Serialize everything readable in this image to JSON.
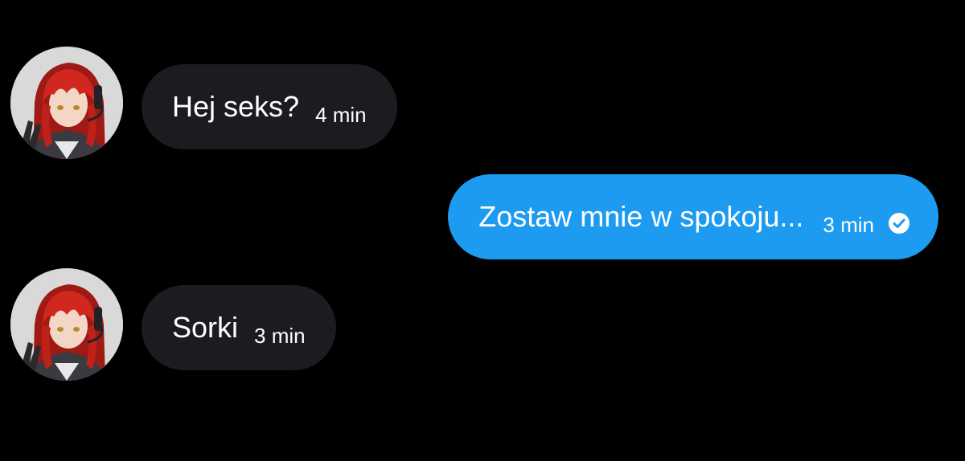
{
  "conversation": {
    "messages": [
      {
        "direction": "incoming",
        "text": "Hej seks?",
        "time": "4 min",
        "avatar_icon": "user-avatar-icon"
      },
      {
        "direction": "outgoing",
        "text": "Zostaw mnie w spokoju...",
        "time": "3 min",
        "status_icon": "read-receipt-check-icon"
      },
      {
        "direction": "incoming",
        "text": "Sorki",
        "time": "3 min",
        "avatar_icon": "user-avatar-icon"
      }
    ]
  },
  "colors": {
    "background": "#000000",
    "incoming_bubble": "#1a1c1f",
    "outgoing_bubble": "#1d9bf0",
    "text": "#ffffff",
    "avatar_hair": "#c0201a"
  }
}
